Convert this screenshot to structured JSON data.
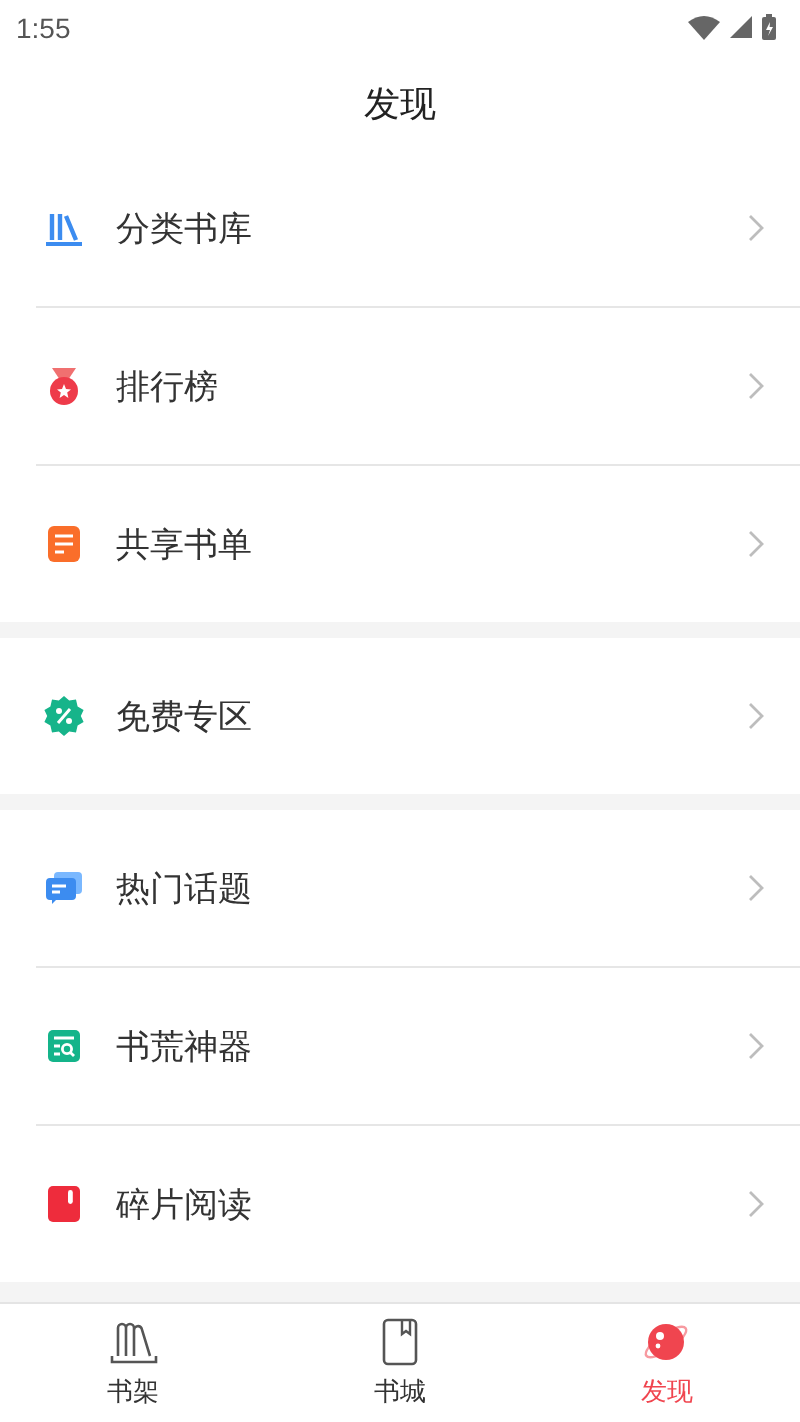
{
  "status_bar": {
    "time": "1:55"
  },
  "header": {
    "title": "发现"
  },
  "groups": [
    {
      "items": [
        {
          "label": "分类书库"
        },
        {
          "label": "排行榜"
        },
        {
          "label": "共享书单"
        }
      ]
    },
    {
      "items": [
        {
          "label": "免费专区"
        }
      ]
    },
    {
      "items": [
        {
          "label": "热门话题"
        },
        {
          "label": "书荒神器"
        },
        {
          "label": "碎片阅读"
        }
      ]
    }
  ],
  "tabs": [
    {
      "label": "书架",
      "selected": false
    },
    {
      "label": "书城",
      "selected": false
    },
    {
      "label": "发现",
      "selected": true
    }
  ]
}
